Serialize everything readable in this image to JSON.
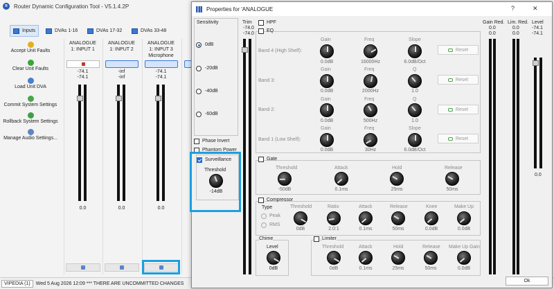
{
  "main": {
    "title": "Router Dynamic Configuration Tool - V5.1.4.2P",
    "tabs": [
      {
        "label": "Inputs"
      },
      {
        "label": "DVAs 1-16"
      },
      {
        "label": "DVAs 17-32"
      },
      {
        "label": "DVAs 33-48"
      }
    ],
    "actions": [
      {
        "label": "Accept Unit Faults",
        "icon": "lightning-icon"
      },
      {
        "label": "Clear Unit Faults",
        "icon": "check-icon"
      },
      {
        "label": "Load Unit DVA",
        "icon": "arrow-icon"
      },
      {
        "label": "Commit System Settings",
        "icon": "commit-icon"
      },
      {
        "label": "Rollback System Settings",
        "icon": "rollback-icon"
      },
      {
        "label": "Manage Audio Settings...",
        "icon": "settings-icon"
      }
    ],
    "strips": [
      {
        "line1": "ANALOGUE",
        "line2": "1: INPUT 1",
        "line3": "",
        "level1": "-74.1",
        "level2": "-74.1",
        "gain": "0.0"
      },
      {
        "line1": "ANALOGUE",
        "line2": "1: INPUT 2",
        "line3": "",
        "level1": "-inf",
        "level2": "-inf",
        "gain": "0.0"
      },
      {
        "line1": "ANALOGUE",
        "line2": "1: INPUT 3",
        "line3": "Microphone",
        "level1": "-74.1",
        "level2": "-74.1",
        "gain": "0.0"
      }
    ],
    "status": {
      "unit": "VIPEDIA (1)",
      "text": "Wed 5 Aug 2026 12:09  *** THERE ARE UNCOMMITTED CHANGES"
    }
  },
  "dialog": {
    "title": "Properties for 'ANALOGUE",
    "help": "?",
    "close": "✕",
    "sensitivity": {
      "title": "Sensitivity",
      "options": [
        "0dB",
        "-20dB",
        "-40dB",
        "-60dB"
      ],
      "selected": "0dB"
    },
    "phase_invert": "Phase Invert",
    "phantom_power": "Phantom Power",
    "surveillance": {
      "label": "Surveillance",
      "threshold_label": "Threshold",
      "threshold_value": "-14dB"
    },
    "trim": {
      "label": "Trim",
      "v1": "-74.0",
      "v2": "-74.0"
    },
    "hpf": "HPF",
    "eq": {
      "label": "EQ",
      "reset": "Reset",
      "bands": [
        {
          "name": "Band 4 (High Shelf):",
          "labels": [
            "Gain",
            "Freq",
            "Slope"
          ],
          "values": [
            "0.0dB",
            "16000Hz",
            "6.0dB/Oct"
          ]
        },
        {
          "name": "Band 3:",
          "labels": [
            "Gain",
            "Freq",
            "Q"
          ],
          "values": [
            "0.0dB",
            "2000Hz",
            "1.0"
          ]
        },
        {
          "name": "Band 2:",
          "labels": [
            "Gain",
            "Freq",
            "Q"
          ],
          "values": [
            "0.0dB",
            "500Hz",
            "1.0"
          ]
        },
        {
          "name": "Band 1 (Low Shelf):",
          "labels": [
            "Gain",
            "Freq",
            "Slope"
          ],
          "values": [
            "0.0dB",
            "30Hz",
            "6.0dB/Oct"
          ]
        }
      ]
    },
    "gate": {
      "label": "Gate",
      "params": [
        {
          "label": "Threshold",
          "value": "-50dB"
        },
        {
          "label": "Attack",
          "value": "0.1ms"
        },
        {
          "label": "Hold",
          "value": "25ms"
        },
        {
          "label": "Release",
          "value": "50ms"
        }
      ]
    },
    "compressor": {
      "label": "Compressor",
      "type_label": "Type",
      "types": [
        "Peak",
        "RMS"
      ],
      "params": [
        {
          "label": "Threshold",
          "value": "0dB"
        },
        {
          "label": "Ratio",
          "value": "2.0:1"
        },
        {
          "label": "Attack",
          "value": "0.1ms"
        },
        {
          "label": "Release",
          "value": "50ms"
        },
        {
          "label": "Knee",
          "value": "0.0dB"
        },
        {
          "label": "Make Up",
          "value": "0.0dB"
        }
      ]
    },
    "chime": {
      "label": "Chime",
      "level_label": "Level",
      "level_value": "0dB"
    },
    "limiter": {
      "label": "Limiter",
      "params": [
        {
          "label": "Threshold",
          "value": "0dB"
        },
        {
          "label": "Attack",
          "value": "0.1ms"
        },
        {
          "label": "Hold",
          "value": "25ms"
        },
        {
          "label": "Release",
          "value": "50ms"
        },
        {
          "label": "Make Up Gain",
          "value": "0.0dB"
        }
      ]
    },
    "gain_red": {
      "label": "Gain Red.",
      "v1": "0.0",
      "v2": "0.0"
    },
    "lim_red": {
      "label": "Lim. Red.",
      "v1": "0.0",
      "v2": "0.0"
    },
    "level": {
      "label": "Level",
      "v1": "-74.1",
      "v2": "-74.1",
      "v3": "0.0"
    },
    "ok": "Ok"
  }
}
